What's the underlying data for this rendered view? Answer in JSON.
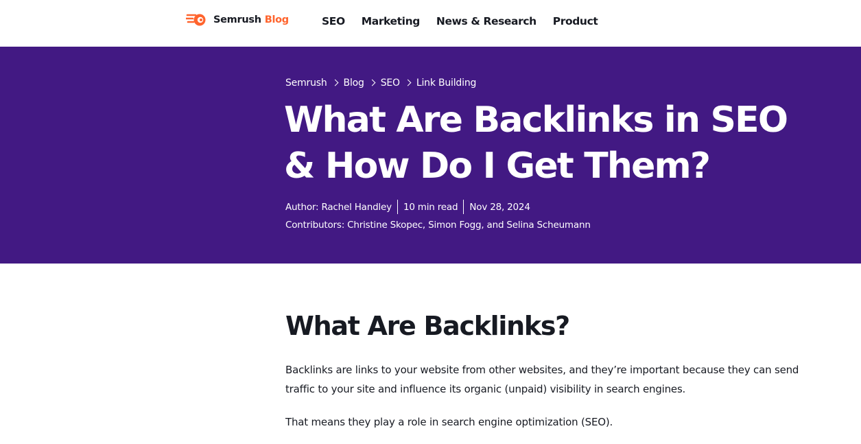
{
  "brand": {
    "name": "Semrush",
    "accent": "Blog",
    "accent_color": "#ff642d",
    "icon": "semrush-flame-icon"
  },
  "nav": {
    "items": [
      {
        "label": "SEO"
      },
      {
        "label": "Marketing"
      },
      {
        "label": "News & Research"
      },
      {
        "label": "Product"
      }
    ]
  },
  "hero": {
    "background_color": "#421983",
    "breadcrumb": [
      "Semrush",
      "Blog",
      "SEO",
      "Link Building"
    ],
    "title": "What Are Backlinks in SEO & How Do I Get Them?",
    "author": "Author: Rachel Handley",
    "read_time": "10 min read",
    "date": "Nov 28, 2024",
    "contributors": "Contributors: Christine Skopec, Simon Fogg, and Selina Scheumann"
  },
  "article": {
    "heading": "What Are Backlinks?",
    "paragraphs": [
      "Backlinks are links to your website from other websites, and they’re important because they can send traffic to your site and influence its organic (unpaid) visibility in search engines.",
      "That means they play a role in search engine optimization (SEO)."
    ]
  }
}
